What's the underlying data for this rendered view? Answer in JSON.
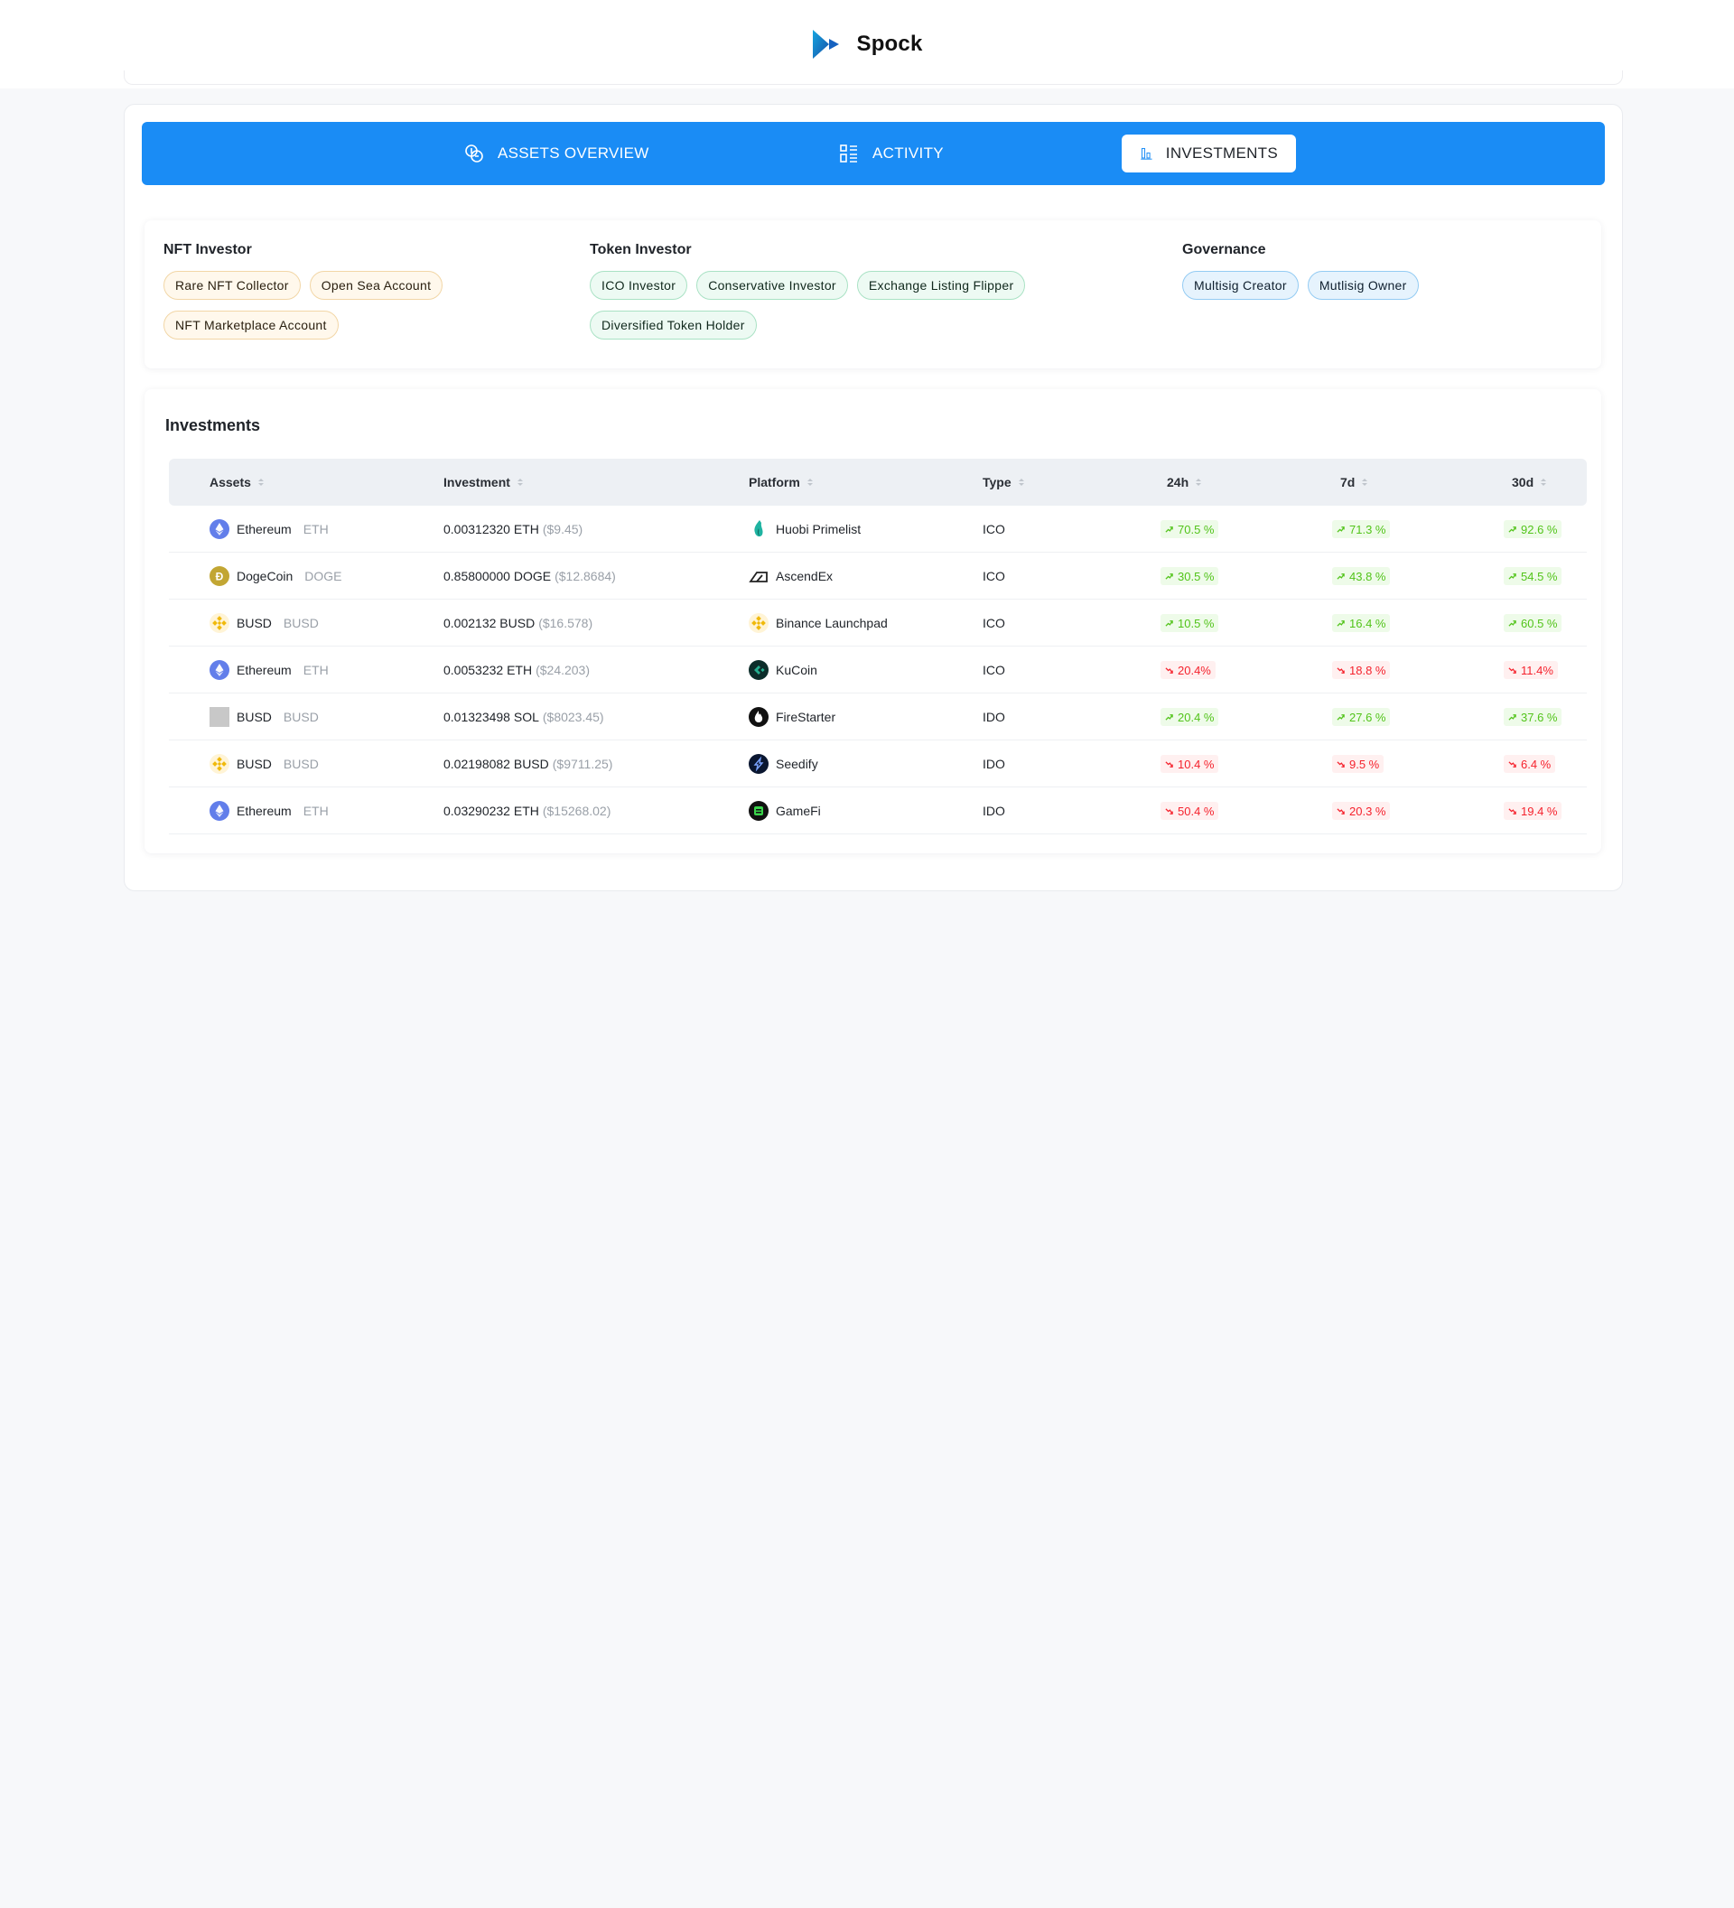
{
  "app": {
    "name": "Spock"
  },
  "tabs": [
    {
      "label": "ASSETS OVERVIEW",
      "icon": "coins-icon",
      "active": false
    },
    {
      "label": "ACTIVITY",
      "icon": "list-icon",
      "active": false
    },
    {
      "label": "INVESTMENTS",
      "icon": "bar-chart-icon",
      "active": true
    }
  ],
  "badges": {
    "nft": {
      "title": "NFT Investor",
      "items": [
        "Rare NFT Collector",
        "Open Sea Account",
        "NFT Marketplace Account"
      ]
    },
    "token": {
      "title": "Token Investor",
      "items": [
        "ICO Investor",
        "Conservative Investor",
        "Exchange Listing Flipper",
        "Diversified Token Holder"
      ]
    },
    "governance": {
      "title": "Governance",
      "items": [
        "Multisig Creator",
        "Mutlisig Owner"
      ]
    }
  },
  "investments": {
    "title": "Investments",
    "columns": [
      "Assets",
      "Investment",
      "Platform",
      "Type",
      "24h",
      "7d",
      "30d"
    ],
    "rows": [
      {
        "asset": "Ethereum",
        "symbol": "ETH",
        "asset_icon": "ethereum-icon",
        "amount": "0.00312320 ETH",
        "usd": "($9.45)",
        "platform": "Huobi Primelist",
        "platform_icon": "huobi-icon",
        "type": "ICO",
        "d24": "70.5 %",
        "d7": "71.3 %",
        "d30": "92.6 %",
        "dir24": "up",
        "dir7": "up",
        "dir30": "up"
      },
      {
        "asset": "DogeCoin",
        "symbol": "DOGE",
        "asset_icon": "dogecoin-icon",
        "amount": "0.85800000 DOGE",
        "usd": "($12.8684)",
        "platform": "AscendEx",
        "platform_icon": "ascendex-icon",
        "type": "ICO",
        "d24": "30.5 %",
        "d7": "43.8 %",
        "d30": "54.5 %",
        "dir24": "up",
        "dir7": "up",
        "dir30": "up"
      },
      {
        "asset": "BUSD",
        "symbol": "BUSD",
        "asset_icon": "busd-icon",
        "amount": "0.002132 BUSD",
        "usd": "($16.578)",
        "platform": "Binance Launchpad",
        "platform_icon": "binance-icon",
        "type": "ICO",
        "d24": "10.5 %",
        "d7": "16.4 %",
        "d30": "60.5 %",
        "dir24": "up",
        "dir7": "up",
        "dir30": "up"
      },
      {
        "asset": "Ethereum",
        "symbol": "ETH",
        "asset_icon": "ethereum-icon",
        "amount": "0.0053232 ETH",
        "usd": "($24.203)",
        "platform": "KuCoin",
        "platform_icon": "kucoin-icon",
        "type": "ICO",
        "d24": "20.4%",
        "d7": "18.8 %",
        "d30": "11.4%",
        "dir24": "down",
        "dir7": "down",
        "dir30": "down"
      },
      {
        "asset": "BUSD",
        "symbol": "BUSD",
        "asset_icon": "placeholder-icon",
        "amount": "0.01323498 SOL",
        "usd": "($8023.45)",
        "platform": "FireStarter",
        "platform_icon": "firestarter-icon",
        "type": "IDO",
        "d24": "20.4 %",
        "d7": "27.6 %",
        "d30": "37.6 %",
        "dir24": "up",
        "dir7": "up",
        "dir30": "up"
      },
      {
        "asset": "BUSD",
        "symbol": "BUSD",
        "asset_icon": "busd-icon",
        "amount": "0.02198082 BUSD",
        "usd": "($9711.25)",
        "platform": "Seedify",
        "platform_icon": "seedify-icon",
        "type": "IDO",
        "d24": "10.4 %",
        "d7": "9.5 %",
        "d30": "6.4 %",
        "dir24": "down",
        "dir7": "down",
        "dir30": "down"
      },
      {
        "asset": "Ethereum",
        "symbol": "ETH",
        "asset_icon": "ethereum-icon",
        "amount": "0.03290232 ETH",
        "usd": "($15268.02)",
        "platform": "GameFi",
        "platform_icon": "gamefi-icon",
        "type": "IDO",
        "d24": "50.4 %",
        "d7": "20.3 %",
        "d30": "19.4 %",
        "dir24": "down",
        "dir7": "down",
        "dir30": "down"
      }
    ]
  },
  "colors": {
    "brand_blue": "#1a8cf5",
    "up_green": "#52c41a",
    "down_red": "#f5222d"
  }
}
